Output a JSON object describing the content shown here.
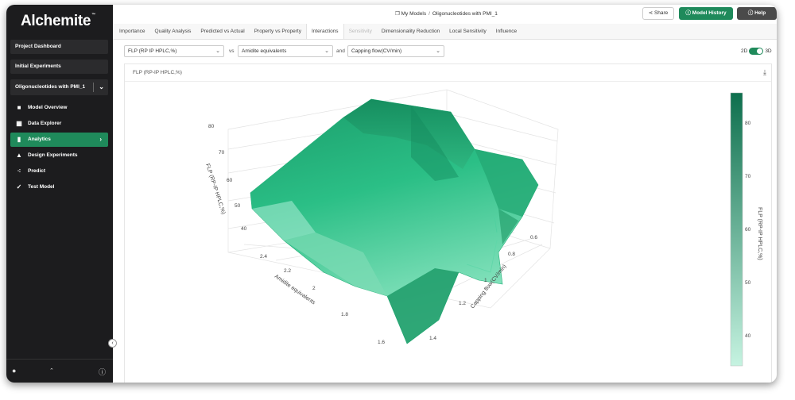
{
  "app": {
    "logo": "Alchemite",
    "logo_mark": "™"
  },
  "sidebar": {
    "project_dashboard": "Project Dashboard",
    "initial_experiments": "Initial Experiments",
    "model_select": "Oligonucleotides with PMI_1",
    "nav": [
      {
        "label": "Model Overview",
        "icon": "camera-icon"
      },
      {
        "label": "Data Explorer",
        "icon": "grid-icon"
      },
      {
        "label": "Analytics",
        "icon": "bar-chart-icon",
        "active": true
      },
      {
        "label": "Design Experiments",
        "icon": "flask-icon"
      },
      {
        "label": "Predict",
        "icon": "scatter-icon"
      },
      {
        "label": "Test Model",
        "icon": "check-icon"
      }
    ]
  },
  "header": {
    "breadcrumb_root": "My Models",
    "breadcrumb_current": "Oligonucleotides with PMI_1",
    "share": "Share",
    "model_history": "Model History",
    "help": "Help"
  },
  "tabs": [
    {
      "label": "Importance"
    },
    {
      "label": "Quality Analysis"
    },
    {
      "label": "Predicted vs Actual"
    },
    {
      "label": "Property vs Property"
    },
    {
      "label": "Interactions",
      "active": true
    },
    {
      "label": "Sensitivity",
      "disabled": true
    },
    {
      "label": "Dimensionality Reduction"
    },
    {
      "label": "Local Sensitivity"
    },
    {
      "label": "Influence"
    }
  ],
  "controls": {
    "property": "FLP (RP IP HPLC,%)",
    "vs_word": "vs",
    "x_param": "Amidite equivalents",
    "and_word": "and",
    "y_param": "Capping flow(CV/min)",
    "toggle_2d": "2D",
    "toggle_3d": "3D"
  },
  "panel": {
    "title": "FLP (RP-IP HPLC,%)"
  },
  "chart_data": {
    "type": "surface",
    "x_axis": {
      "label": "Amidite equivalents",
      "ticks": [
        1.6,
        1.8,
        2,
        2.2,
        2.4
      ]
    },
    "y_axis": {
      "label": "Capping flow(CV/min)",
      "ticks": [
        1.4,
        1.2,
        1,
        0.8,
        0.6
      ]
    },
    "z_axis": {
      "label": "FLP (RP-IP HPLC,%)",
      "ticks": [
        40,
        50,
        60,
        70,
        80
      ]
    },
    "colorbar": {
      "label": "FLP (RP-IP HPLC,%)",
      "ticks": [
        40,
        50,
        60,
        70,
        80
      ],
      "range": [
        35,
        86
      ],
      "low_color": "#c6f3e1",
      "high_color": "#0d6f4d"
    },
    "surface_color": "#2bbf86"
  }
}
